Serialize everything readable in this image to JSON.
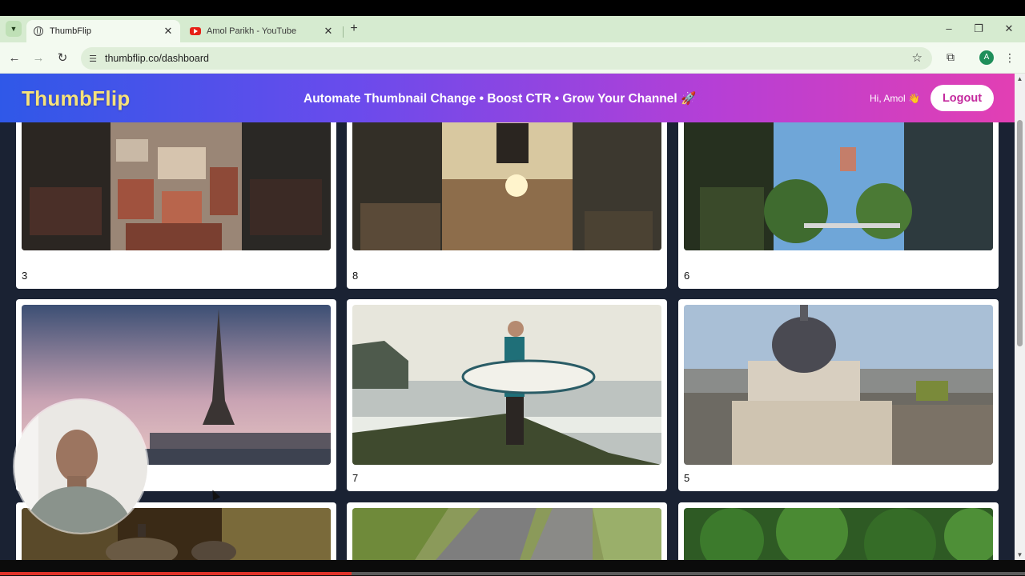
{
  "browser": {
    "tabs": [
      {
        "title": "ThumbFlip",
        "favicon": "globe-icon",
        "active": true
      },
      {
        "title": "Amol Parikh - YouTube",
        "favicon": "youtube-icon",
        "active": false
      }
    ],
    "new_tab_label": "+",
    "url": "thumbflip.co/dashboard",
    "profile_initial": "A"
  },
  "header": {
    "brand": "ThumbFlip",
    "tagline": "Automate Thumbnail Change • Boost CTR • Grow Your Channel 🚀",
    "greeting": "Hi, Amol 👋",
    "logout_label": "Logout",
    "brand_color": "#f6e27a",
    "gradient": [
      "#2f58e8",
      "#6a4bec",
      "#b53fd6",
      "#e23fb3"
    ]
  },
  "videos": [
    {
      "label": "3",
      "scene": "aerial-venice-rooftops"
    },
    {
      "label": "8",
      "scene": "skateboarder-sunset"
    },
    {
      "label": "6",
      "scene": "swing-ride-trees"
    },
    {
      "label": "",
      "scene": "eiffel-tower-dusk"
    },
    {
      "label": "7",
      "scene": "surfer-on-rocks"
    },
    {
      "label": "5",
      "scene": "domed-building-vienna"
    },
    {
      "label": "",
      "scene": "teapot-tea-set"
    },
    {
      "label": "",
      "scene": "aerial-highway"
    },
    {
      "label": "",
      "scene": "green-forest"
    }
  ],
  "video_progress": 0.343
}
